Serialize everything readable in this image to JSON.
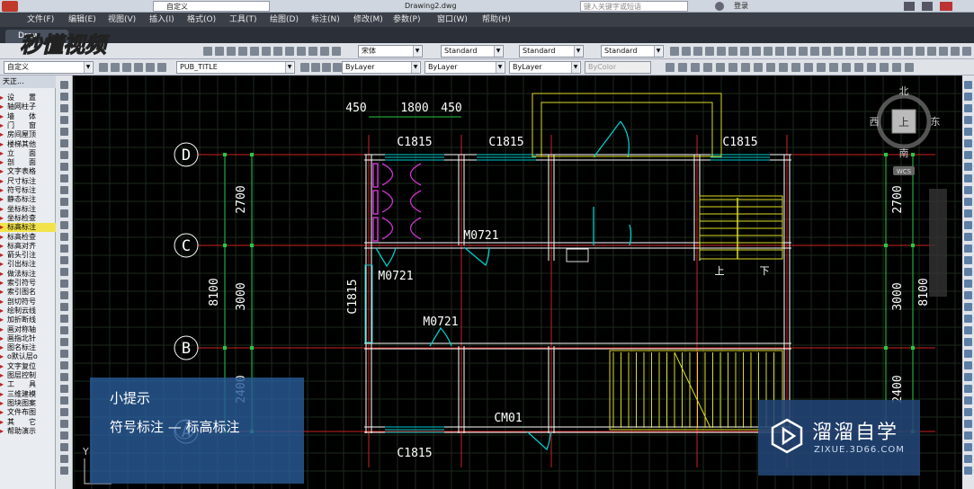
{
  "titlebar": {
    "workspace": "自定义",
    "doc_title": "Drawing2.dwg",
    "search_placeholder": "键入关键字或短语",
    "login": "登录"
  },
  "menu": [
    "文件(F)",
    "编辑(E)",
    "视图(V)",
    "插入(I)",
    "格式(O)",
    "工具(T)",
    "绘图(D)",
    "标注(N)",
    "修改(M)",
    "参数(P)",
    "窗口(W)",
    "帮助(H)"
  ],
  "tab": {
    "label": "Draw"
  },
  "toolbar1": {
    "font_combo": "宋体",
    "text_style": "Standard",
    "dim_style": "Standard",
    "table_style": "Standard"
  },
  "toolbar2": {
    "workspace_combo": "自定义",
    "layer_combo": "PUB_TITLE",
    "color_combo": "ByLayer",
    "linetype_combo": "ByLayer",
    "lineweight_combo": "ByLayer",
    "plotstyle_combo": "ByColor"
  },
  "leftpanel": {
    "header": "天正...",
    "items": [
      "设　　置",
      "轴网柱子",
      "墙　　体",
      "门　　窗",
      "房间屋顶",
      "楼梯其他",
      "立　　面",
      "剖　　面",
      "文字表格",
      "尺寸标注",
      "符号标注",
      "静态标注",
      "坐标标注",
      "坐标检查",
      "标高标注",
      "标高检查",
      "标高对齐",
      "箭头引注",
      "引出标注",
      "做法标注",
      "索引符号",
      "索引图名",
      "剖切符号",
      "绘制云线",
      "加折断线",
      "画对称轴",
      "画指北针",
      "图名标注",
      "o默认层o",
      "文字复位",
      "图层控制",
      "工　　具",
      "三维建模",
      "图块图案",
      "文件布图",
      "其　　它",
      "帮助演示"
    ]
  },
  "drawing": {
    "axes": [
      "D",
      "C",
      "B",
      "A"
    ],
    "top_dims": [
      "450",
      "1800",
      "450"
    ],
    "windows": [
      "C1815",
      "C1815",
      "C1815",
      "C1815",
      "C1815",
      "CM01"
    ],
    "doors": [
      "M0721",
      "M0721",
      "M0721"
    ],
    "left_dims": [
      "2700",
      "3000",
      "2400"
    ],
    "left_total": "8100",
    "right_dims": [
      "2700",
      "3000",
      "2400"
    ],
    "right_total": "8100",
    "stair_labels": [
      "上",
      "下"
    ],
    "ucs_y": "Y"
  },
  "viewcube": {
    "north": "北",
    "south": "南",
    "east": "东",
    "west": "西",
    "face": "上",
    "wcs": "WCS"
  },
  "tip": {
    "title": "小提示",
    "body": "符号标注 — 标高标注"
  },
  "watermark": {
    "brand": "溜溜自学",
    "url": "ZIXUE.3D66.COM",
    "channel_logo": "秒懂视频"
  },
  "colors": {
    "grid": "#1b2a1b",
    "axis": "#cc2222",
    "wall": "#ffffff",
    "dim": "#22cc44",
    "window": "#00cccc",
    "stair": "#dddd22",
    "text": "#ffffff"
  }
}
